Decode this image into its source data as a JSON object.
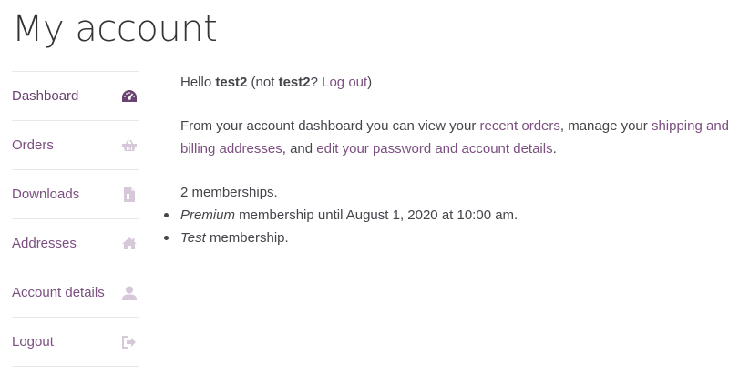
{
  "page": {
    "title": "My account"
  },
  "colors": {
    "accent": "#7b4f80",
    "text": "#43454b",
    "icon_active": "#6b4372",
    "icon_muted": "#d6c8d9"
  },
  "nav": {
    "items": [
      {
        "label": "Dashboard",
        "icon": "dashboard-gauge-icon",
        "active": true
      },
      {
        "label": "Orders",
        "icon": "basket-icon",
        "active": false
      },
      {
        "label": "Downloads",
        "icon": "file-icon",
        "active": false
      },
      {
        "label": "Addresses",
        "icon": "home-icon",
        "active": false
      },
      {
        "label": "Account details",
        "icon": "user-icon",
        "active": false
      },
      {
        "label": "Logout",
        "icon": "logout-icon",
        "active": false
      }
    ]
  },
  "content": {
    "hello": {
      "prefix": "Hello ",
      "username": "test2",
      "paren_open": " (not ",
      "username2": "test2",
      "question": "? ",
      "logout_link": "Log out",
      "paren_close": ")"
    },
    "intro": {
      "t1": "From your account dashboard you can view your ",
      "link_orders": "recent orders",
      "t2": ", manage your ",
      "link_addresses": "shipping and billing addresses",
      "t3": ", and ",
      "link_account": "edit your password and account details",
      "t4": "."
    },
    "memberships": {
      "count_text": "2 memberships.",
      "items": [
        {
          "name": "Premium",
          "rest": " membership until August 1, 2020 at 10:00 am."
        },
        {
          "name": "Test",
          "rest": " membership."
        }
      ]
    }
  }
}
